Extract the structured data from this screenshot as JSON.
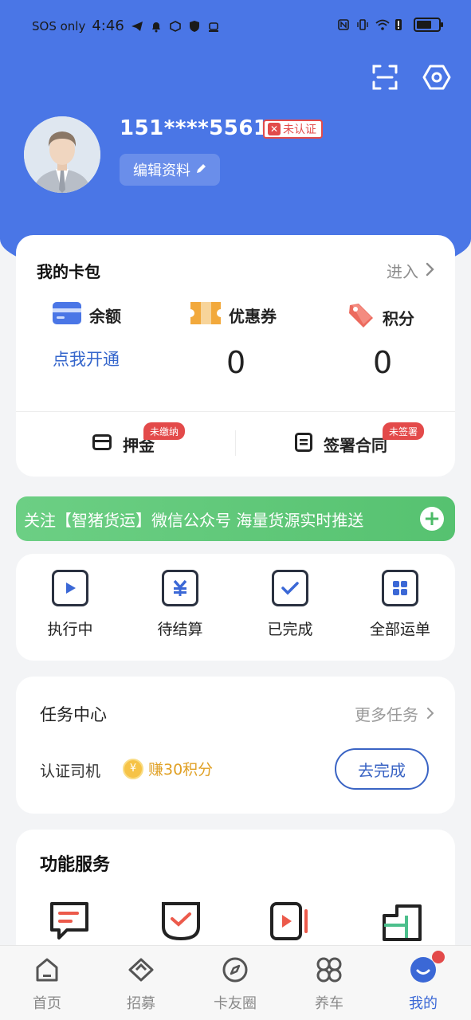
{
  "status_bar": {
    "carrier": "SOS only",
    "time": "4:46"
  },
  "profile": {
    "phone": "151****5561",
    "cert_status": "未认证",
    "edit_label": "编辑资料"
  },
  "wallet": {
    "title": "我的卡包",
    "enter_label": "进入",
    "balance_label": "余额",
    "balance_action": "点我开通",
    "coupon_label": "优惠券",
    "coupon_value": "0",
    "points_label": "积分",
    "points_value": "0",
    "deposit_label": "押金",
    "deposit_tag": "未缴纳",
    "contract_label": "签署合同",
    "contract_tag": "未签署"
  },
  "banner": {
    "text": "关注【智猪货运】微信公众号 海量货源实时推送"
  },
  "orders": {
    "items": [
      {
        "label": "执行中"
      },
      {
        "label": "待结算"
      },
      {
        "label": "已完成"
      },
      {
        "label": "全部运单"
      }
    ]
  },
  "tasks": {
    "title": "任务中心",
    "more_label": "更多任务",
    "item_label": "认证司机",
    "reward": "赚30积分",
    "action_label": "去完成"
  },
  "services": {
    "title": "功能服务"
  },
  "tabbar": {
    "items": [
      {
        "label": "首页"
      },
      {
        "label": "招募"
      },
      {
        "label": "卡友圈"
      },
      {
        "label": "养车"
      },
      {
        "label": "我的"
      }
    ],
    "active_index": 4
  },
  "colors": {
    "primary": "#4a76e6",
    "banner_green": "#5cc476",
    "badge_red": "#e34a4a",
    "link_blue": "#3566cc"
  }
}
